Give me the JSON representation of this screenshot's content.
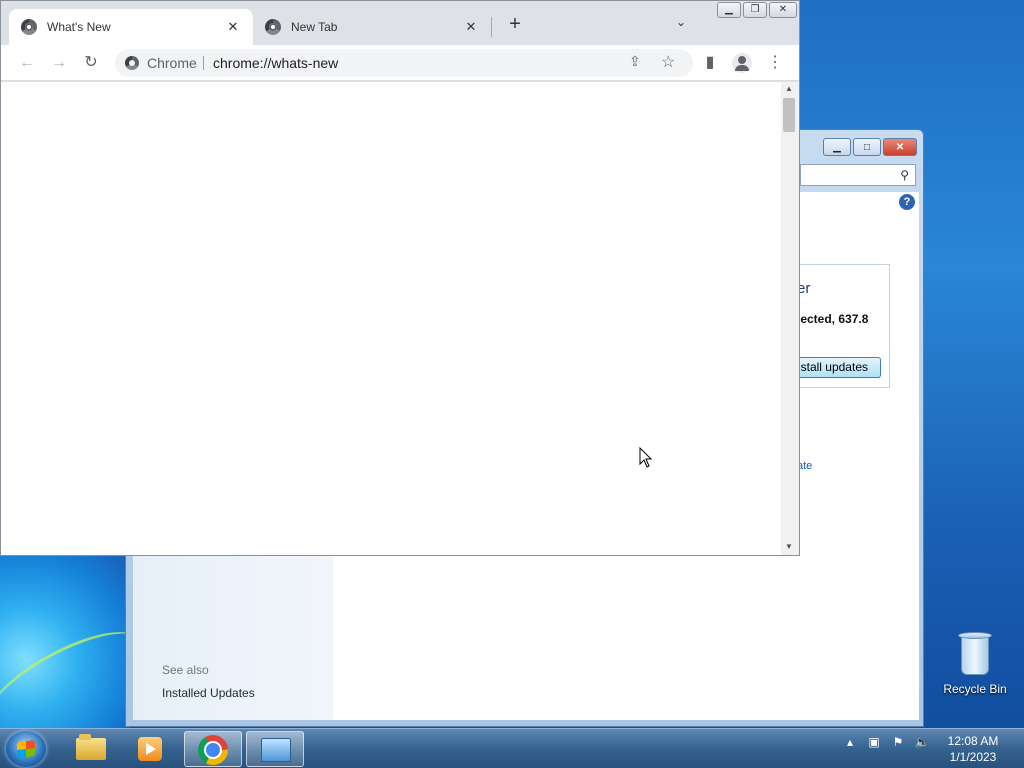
{
  "desktop": {
    "recycle_bin_label": "Recycle Bin"
  },
  "background_window": {
    "update_title_fragment": "er",
    "update_detail_fragment": "lected, 637.8",
    "install_button_fragment": "stall updates",
    "link_fragment": "ate",
    "see_also_label": "See also",
    "installed_updates_link": "Installed Updates",
    "help_icon": "?"
  },
  "chrome": {
    "tabs": [
      {
        "title": "What's New",
        "active": true
      },
      {
        "title": "New Tab",
        "active": false
      }
    ],
    "omnibox": {
      "site_name": "Chrome",
      "url": "chrome://whats-new"
    },
    "icons": {
      "back": "back-arrow-icon",
      "forward": "forward-arrow-icon",
      "reload": "reload-icon",
      "share": "share-icon",
      "bookmark": "star-icon",
      "side_panel": "side-panel-icon",
      "profile": "profile-icon",
      "menu": "kebab-menu-icon"
    }
  },
  "taskbar": {
    "clock_time": "12:08 AM",
    "clock_date": "1/1/2023"
  }
}
